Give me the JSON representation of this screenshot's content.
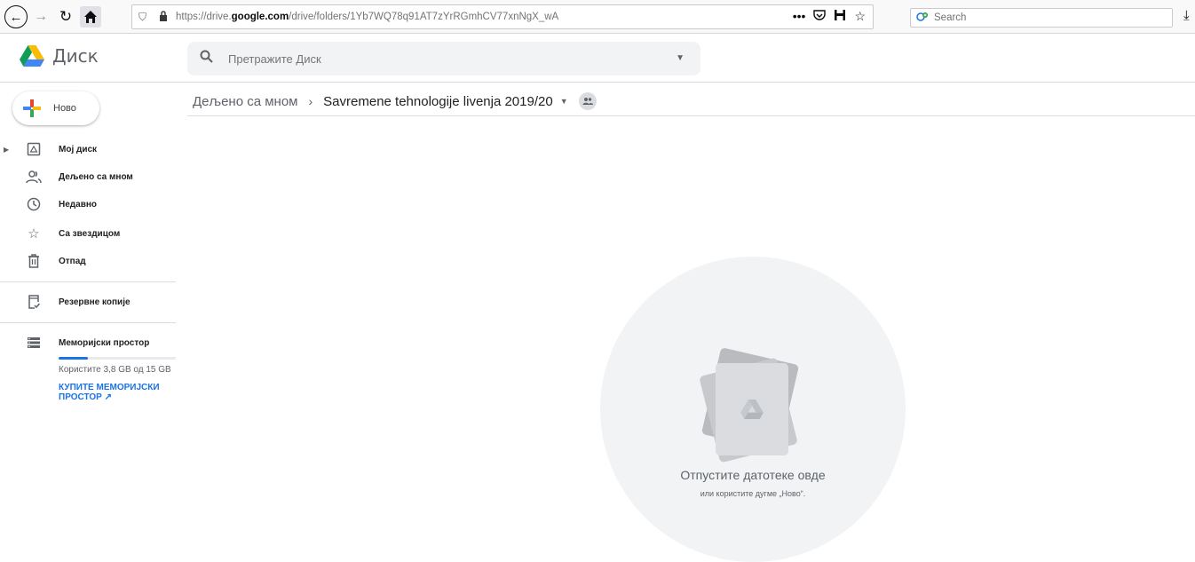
{
  "browser": {
    "url_prefix": "https://drive.",
    "url_domain": "google.com",
    "url_path": "/drive/folders/1Yb7WQ78q91AT7zYrRGmhCV77xnNgX_wA",
    "search_placeholder": "Search",
    "more_label": "•••"
  },
  "header": {
    "logo_text": "Диск",
    "search_placeholder": "Претражите Диск"
  },
  "sidebar": {
    "new_label": "Ново",
    "items": [
      {
        "label": "Мој диск",
        "icon": "my-drive-icon"
      },
      {
        "label": "Дељено са мном",
        "icon": "shared-people-icon"
      },
      {
        "label": "Недавно",
        "icon": "clock-icon"
      },
      {
        "label": "Са звездицом",
        "icon": "star-icon"
      },
      {
        "label": "Отпад",
        "icon": "trash-icon"
      }
    ],
    "backups_label": "Резервне копије",
    "storage_label": "Меморијски простор",
    "storage_text": "Користите 3,8 GB од 15 GB",
    "storage_fraction": 0.25,
    "buy_storage_label": "КУПИТЕ МЕМОРИЈСКИ ПРОСТОР"
  },
  "breadcrumb": {
    "root": "Дељено са мном",
    "current": "Savremene tehnologije livenja 2019/20"
  },
  "empty_state": {
    "title": "Отпустите датотеке овде",
    "subtitle": "или користите дугме „Ново“."
  },
  "colors": {
    "accent": "#1a73e8",
    "drive_green": "#0f9d58",
    "drive_yellow": "#fbbc05",
    "drive_blue": "#4285f4"
  }
}
